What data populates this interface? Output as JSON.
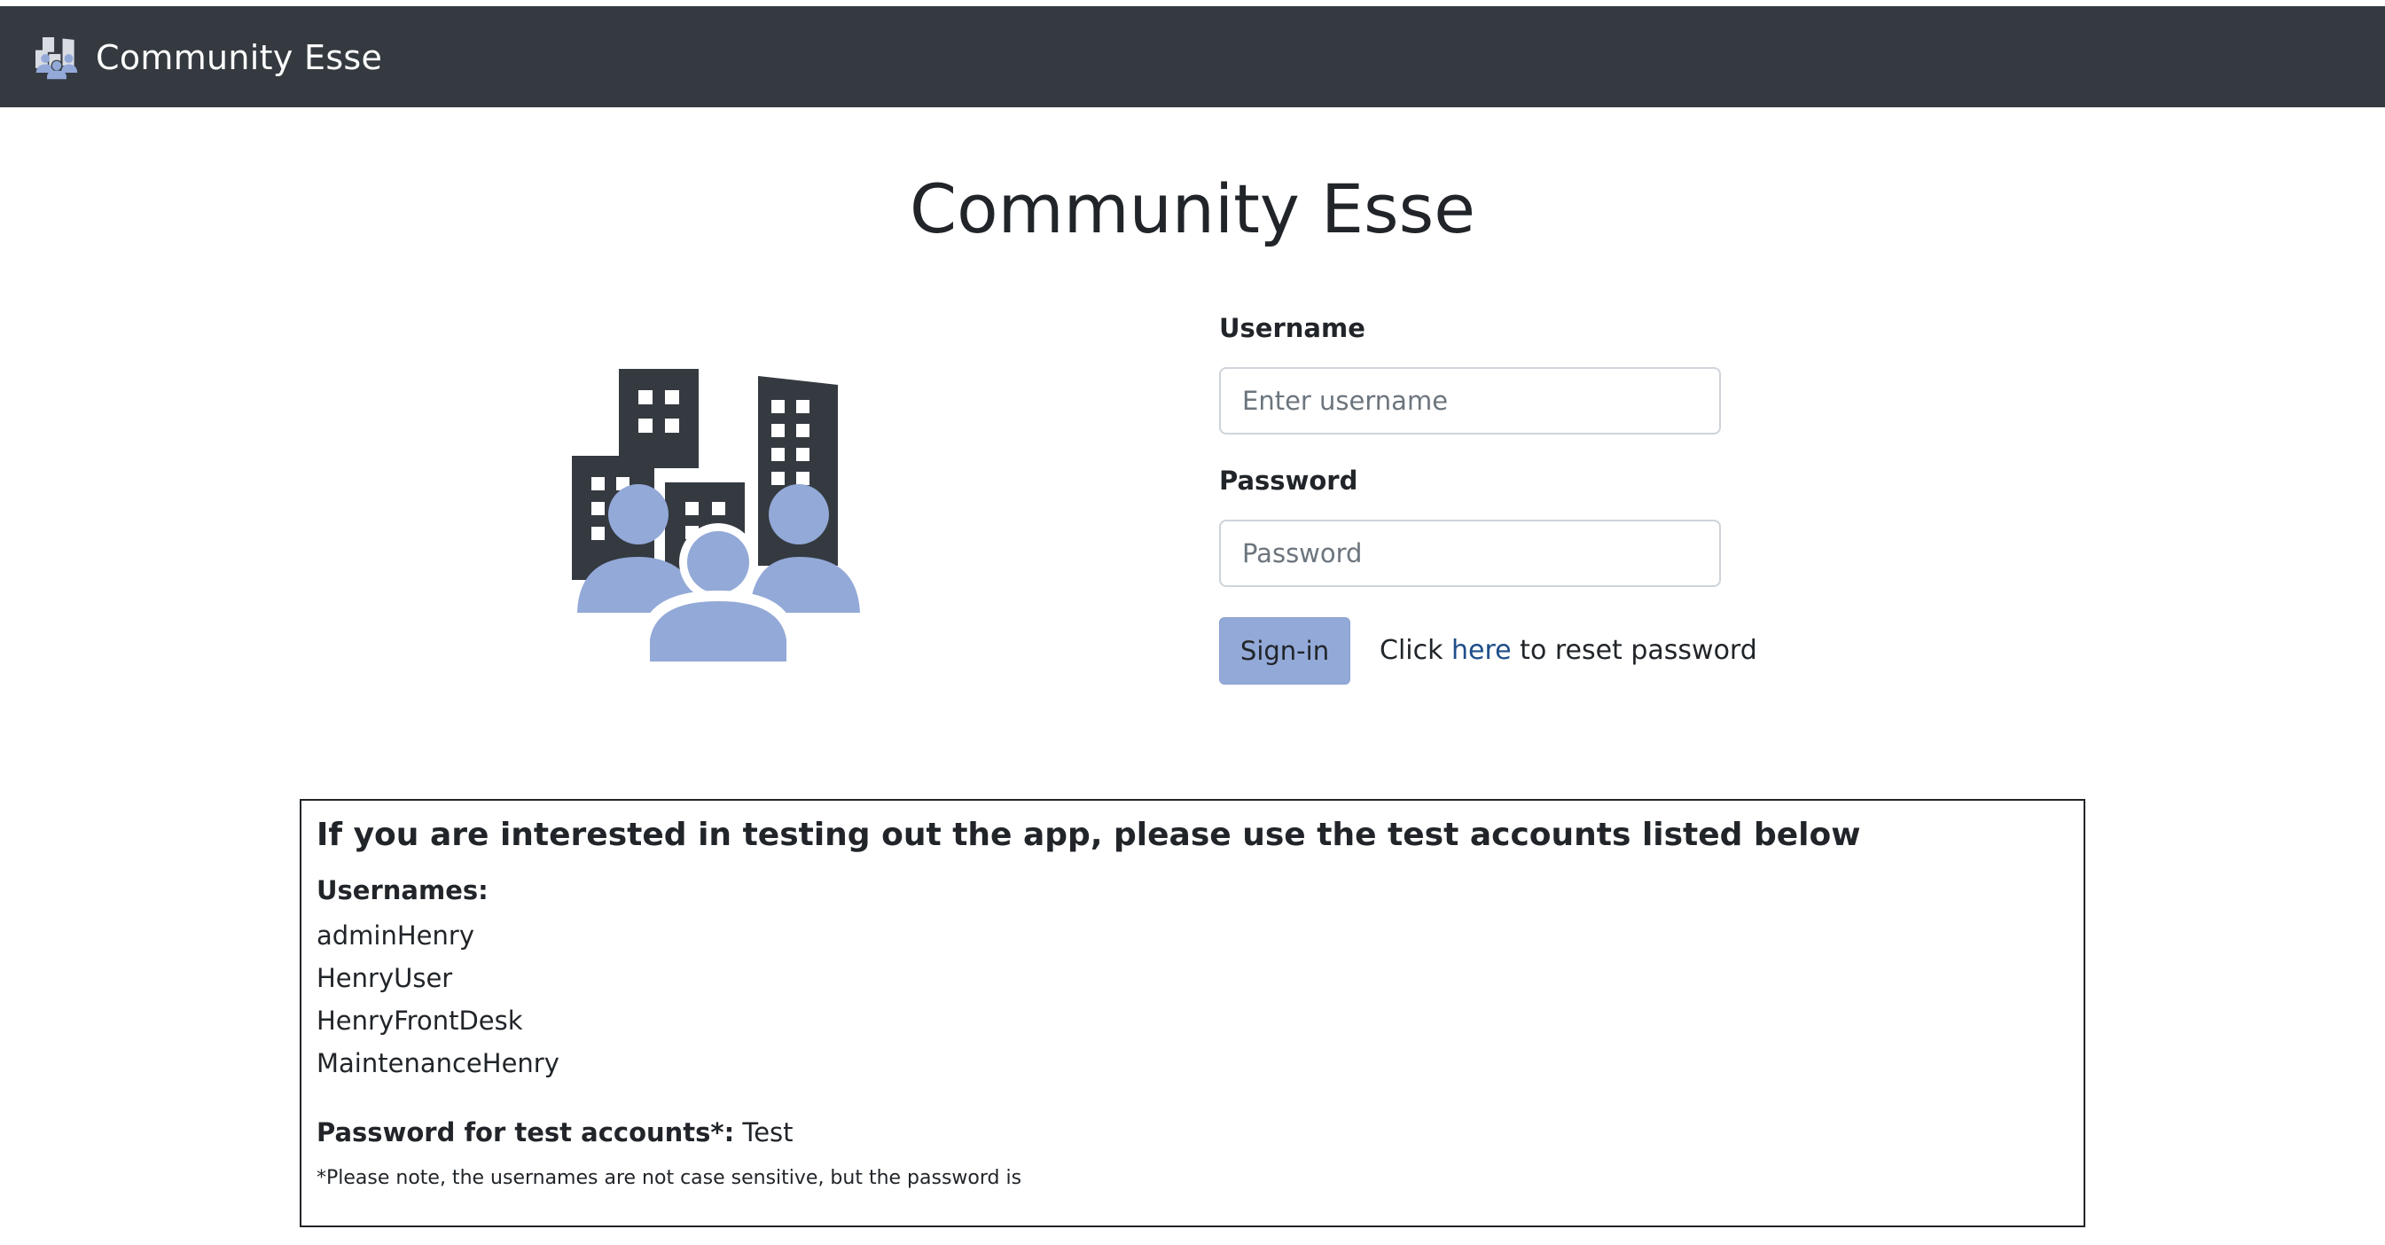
{
  "navbar": {
    "brand": "Community Esse",
    "logo_icon": "community-buildings-icon"
  },
  "main": {
    "title": "Community Esse",
    "hero_icon": "community-buildings-icon"
  },
  "login_form": {
    "username_label": "Username",
    "username_placeholder": "Enter username",
    "username_value": "",
    "password_label": "Password",
    "password_placeholder": "Password",
    "password_value": "",
    "signin_label": "Sign-in",
    "reset_prefix": "Click ",
    "reset_link": "here",
    "reset_suffix": " to reset password"
  },
  "test_accounts": {
    "heading": "If you are interested in testing out the app, please use the test accounts listed below",
    "usernames_label": "Usernames:",
    "usernames": [
      "adminHenry",
      "HenryUser",
      "HenryFrontDesk",
      "MaintenanceHenry"
    ],
    "password_label": "Password for test accounts*:",
    "password_value": " Test",
    "note": "*Please note, the usernames are not case sensitive, but the password is"
  },
  "colors": {
    "navbar_bg": "#343a40",
    "accent": "#93a9d8",
    "building": "#343a40",
    "link": "#1f4e8a"
  }
}
